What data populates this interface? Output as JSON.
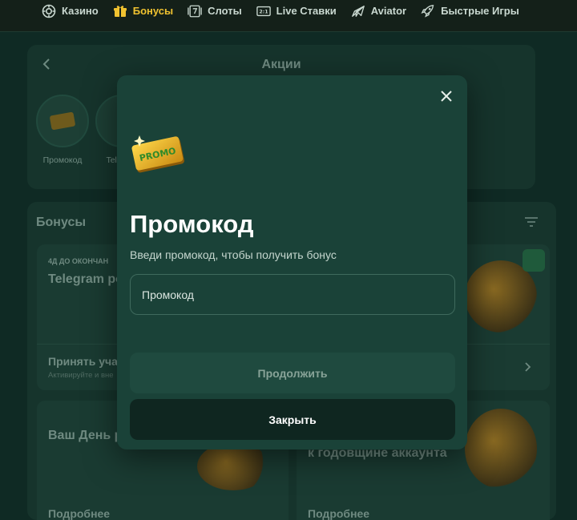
{
  "nav": {
    "items": [
      {
        "label": "Казино",
        "icon": "casino-chip-icon",
        "active": false
      },
      {
        "label": "Бонусы",
        "icon": "gift-icon",
        "active": true
      },
      {
        "label": "Слоты",
        "icon": "slot-7-icon",
        "active": false
      },
      {
        "label": "Live Ставки",
        "icon": "live-scoreboard-icon",
        "active": false
      },
      {
        "label": "Aviator",
        "icon": "plane-icon",
        "active": false
      },
      {
        "label": "Быстрые Игры",
        "icon": "rocket-icon",
        "active": false
      }
    ],
    "active_color": "#f0c230"
  },
  "promotions": {
    "title": "Акции",
    "stories": [
      {
        "label": "Промокод"
      },
      {
        "label": "Tele cha"
      }
    ]
  },
  "bonuses": {
    "title": "Бонусы",
    "cards": [
      {
        "badge": "4Д ДО ОКОНЧАН",
        "heading": "Telegram ро 250 000₸ и",
        "action": "Принять учас",
        "sub": "Активируйте и вне"
      },
      {
        "heading": "Ваш День р вместе с Sultan!",
        "more": "Подробнее"
      },
      {
        "heading": "к годовщине аккаунта",
        "more": "Подробнее"
      }
    ]
  },
  "modal": {
    "promo_art_text": "PROMO",
    "title": "Промокод",
    "subtitle": "Введи промокод, чтобы получить бонус",
    "input_placeholder": "Промокод",
    "input_value": "",
    "continue_label": "Продолжить",
    "close_label": "Закрыть"
  },
  "colors": {
    "background": "#0f2a24",
    "modal": "#1a4238",
    "accent": "#f0c230"
  }
}
